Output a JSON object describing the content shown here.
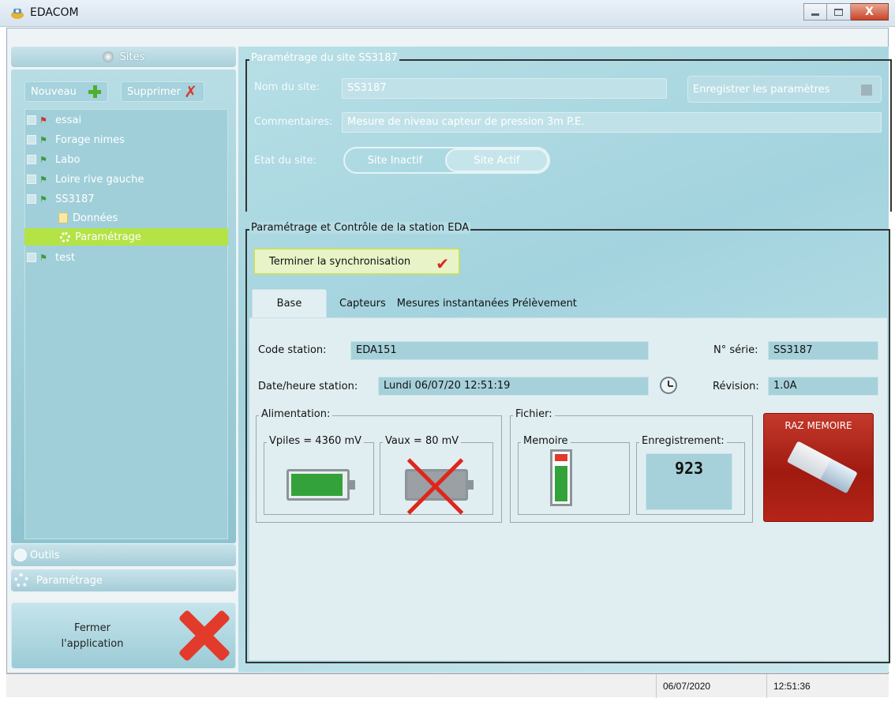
{
  "window": {
    "title": "EDACOM",
    "close_label": "X"
  },
  "sidebar": {
    "sites_label": "Sites",
    "new_label": "Nouveau",
    "delete_label": "Supprimer",
    "tree": [
      {
        "label": "essai"
      },
      {
        "label": "Forage nimes"
      },
      {
        "label": "Labo"
      },
      {
        "label": "Loire rive gauche"
      },
      {
        "label": "SS3187"
      },
      {
        "label": "Données"
      },
      {
        "label": "Paramétrage"
      },
      {
        "label": "test"
      }
    ],
    "tools_label": "Outils",
    "settings_label": "Paramétrage",
    "close_app_label_1": "Fermer",
    "close_app_label_2": "l'application"
  },
  "site_settings": {
    "group_title": "Paramétrage du site SS3187",
    "name_label": "Nom du site:",
    "name_value": "SS3187",
    "save_label": "Enregistrer les paramètres",
    "comments_label": "Commentaires:",
    "comments_value": "Mesure de niveau capteur de pression 3m P.E.",
    "state_label": "Etat du site:",
    "state_inactive": "Site Inactif",
    "state_active": "Site Actif"
  },
  "station": {
    "group_title": "Paramétrage et Contrôle de la station EDA",
    "sync_label": "Terminer la synchronisation",
    "tabs": [
      "Base",
      "Capteurs",
      "Mesures instantanées",
      "Prélèvement"
    ],
    "code_label": "Code station:",
    "code_value": "EDA151",
    "serial_label": "N° série:",
    "serial_value": "SS3187",
    "datetime_label": "Date/heure station:",
    "datetime_value": "Lundi 06/07/20 12:51:19",
    "revision_label": "Révision:",
    "revision_value": "1.0A",
    "power_label": "Alimentation:",
    "vpiles_label": "Vpiles = 4360 mV",
    "vaux_label": "Vaux = 80 mV",
    "vpiles_level": 0.95,
    "file_label": "Fichier:",
    "memory_label": "Memoire",
    "memory_level": 0.75,
    "record_label": "Enregistrement:",
    "record_value": "923",
    "raz_label": "RAZ MEMOIRE"
  },
  "statusbar": {
    "date": "06/07/2020",
    "time": "12:51:36"
  },
  "colors": {
    "accent": "#a3d3de",
    "selected": "#b4e345",
    "danger": "#e23b2b"
  }
}
